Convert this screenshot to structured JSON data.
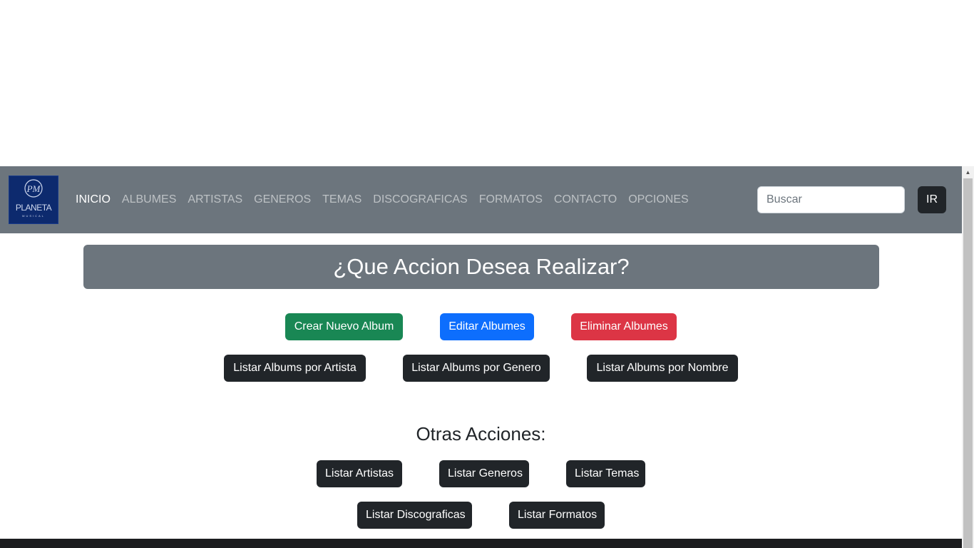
{
  "navbar": {
    "logo_text": "PLANETA MUSICAL",
    "links": [
      {
        "label": "INICIO",
        "active": true
      },
      {
        "label": "ALBUMES",
        "active": false
      },
      {
        "label": "ARTISTAS",
        "active": false
      },
      {
        "label": "GENEROS",
        "active": false
      },
      {
        "label": "TEMAS",
        "active": false
      },
      {
        "label": "DISCOGRAFICAS",
        "active": false
      },
      {
        "label": "FORMATOS",
        "active": false
      },
      {
        "label": "CONTACTO",
        "active": false
      },
      {
        "label": "OPCIONES",
        "active": false
      }
    ],
    "search_placeholder": "Buscar",
    "search_value": "",
    "go_label": "IR"
  },
  "main": {
    "title": "¿Que Accion Desea Realizar?",
    "primary_actions": [
      {
        "label": "Crear Nuevo Album",
        "color": "#198754"
      },
      {
        "label": "Editar Albumes",
        "color": "#0d6efd"
      },
      {
        "label": "Eliminar Albumes",
        "color": "#dc3545"
      }
    ],
    "list_actions": [
      {
        "label": "Listar Albums por Artista"
      },
      {
        "label": "Listar Albums por Genero"
      },
      {
        "label": "Listar Albums por Nombre"
      }
    ],
    "other_title": "Otras Acciones:",
    "other_actions": [
      {
        "label": "Listar Artistas"
      },
      {
        "label": "Listar Generos"
      },
      {
        "label": "Listar Temas"
      },
      {
        "label": "Listar Discograficas"
      },
      {
        "label": "Listar Formatos"
      }
    ]
  },
  "colors": {
    "navbar_bg": "#6c757d",
    "dark": "#212529",
    "success": "#198754",
    "primary": "#0d6efd",
    "danger": "#dc3545",
    "logo_bg": "#0d2a6e"
  }
}
